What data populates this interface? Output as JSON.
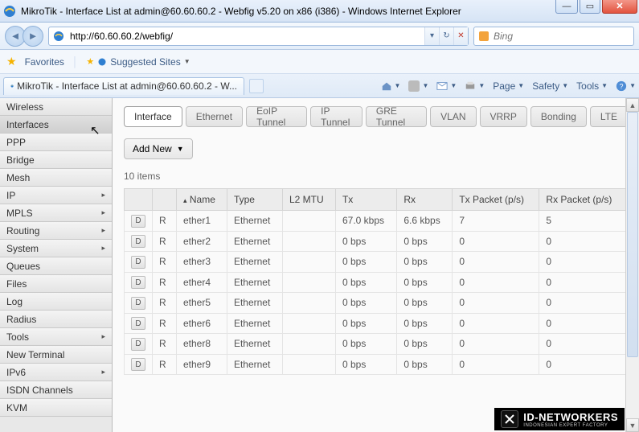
{
  "window": {
    "title": "MikroTik - Interface List at admin@60.60.60.2 - Webfig v5.20 on x86 (i386) - Windows Internet Explorer"
  },
  "address": {
    "url": "http://60.60.60.2/webfig/"
  },
  "search": {
    "placeholder": "Bing"
  },
  "favorites": {
    "label": "Favorites",
    "suggested": "Suggested Sites"
  },
  "ietab": {
    "label": "MikroTik - Interface List at admin@60.60.60.2 - W..."
  },
  "ie_tools": {
    "page": "Page",
    "safety": "Safety",
    "tools": "Tools"
  },
  "sidebar": {
    "items": [
      {
        "label": "Wireless",
        "sub": false
      },
      {
        "label": "Interfaces",
        "sub": false,
        "active": true
      },
      {
        "label": "PPP",
        "sub": false
      },
      {
        "label": "Bridge",
        "sub": false
      },
      {
        "label": "Mesh",
        "sub": false
      },
      {
        "label": "IP",
        "sub": true
      },
      {
        "label": "MPLS",
        "sub": true
      },
      {
        "label": "Routing",
        "sub": true
      },
      {
        "label": "System",
        "sub": true
      },
      {
        "label": "Queues",
        "sub": false
      },
      {
        "label": "Files",
        "sub": false
      },
      {
        "label": "Log",
        "sub": false
      },
      {
        "label": "Radius",
        "sub": false
      },
      {
        "label": "Tools",
        "sub": true
      },
      {
        "label": "New Terminal",
        "sub": false
      },
      {
        "label": "IPv6",
        "sub": true
      },
      {
        "label": "ISDN Channels",
        "sub": false
      },
      {
        "label": "KVM",
        "sub": false
      }
    ]
  },
  "tabs": [
    {
      "label": "Interface",
      "active": true
    },
    {
      "label": "Ethernet"
    },
    {
      "label": "EoIP Tunnel"
    },
    {
      "label": "IP Tunnel"
    },
    {
      "label": "GRE Tunnel"
    },
    {
      "label": "VLAN"
    },
    {
      "label": "VRRP"
    },
    {
      "label": "Bonding"
    },
    {
      "label": "LTE"
    }
  ],
  "addnew": "Add New",
  "itemcount": "10 items",
  "table": {
    "headers": {
      "d": "",
      "flag": "",
      "name": "Name",
      "type": "Type",
      "l2mtu": "L2 MTU",
      "tx": "Tx",
      "rx": "Rx",
      "txp": "Tx Packet (p/s)",
      "rxp": "Rx Packet (p/s)"
    },
    "rows": [
      {
        "d": "D",
        "flag": "R",
        "name": "ether1",
        "type": "Ethernet",
        "l2mtu": "",
        "tx": "67.0 kbps",
        "rx": "6.6 kbps",
        "txp": "7",
        "rxp": "5"
      },
      {
        "d": "D",
        "flag": "R",
        "name": "ether2",
        "type": "Ethernet",
        "l2mtu": "",
        "tx": "0 bps",
        "rx": "0 bps",
        "txp": "0",
        "rxp": "0"
      },
      {
        "d": "D",
        "flag": "R",
        "name": "ether3",
        "type": "Ethernet",
        "l2mtu": "",
        "tx": "0 bps",
        "rx": "0 bps",
        "txp": "0",
        "rxp": "0"
      },
      {
        "d": "D",
        "flag": "R",
        "name": "ether4",
        "type": "Ethernet",
        "l2mtu": "",
        "tx": "0 bps",
        "rx": "0 bps",
        "txp": "0",
        "rxp": "0"
      },
      {
        "d": "D",
        "flag": "R",
        "name": "ether5",
        "type": "Ethernet",
        "l2mtu": "",
        "tx": "0 bps",
        "rx": "0 bps",
        "txp": "0",
        "rxp": "0"
      },
      {
        "d": "D",
        "flag": "R",
        "name": "ether6",
        "type": "Ethernet",
        "l2mtu": "",
        "tx": "0 bps",
        "rx": "0 bps",
        "txp": "0",
        "rxp": "0"
      },
      {
        "d": "D",
        "flag": "R",
        "name": "ether8",
        "type": "Ethernet",
        "l2mtu": "",
        "tx": "0 bps",
        "rx": "0 bps",
        "txp": "0",
        "rxp": "0"
      },
      {
        "d": "D",
        "flag": "R",
        "name": "ether9",
        "type": "Ethernet",
        "l2mtu": "",
        "tx": "0 bps",
        "rx": "0 bps",
        "txp": "0",
        "rxp": "0"
      }
    ]
  },
  "watermark": {
    "name": "ID-NETWORKERS",
    "sub": "INDONESIAN EXPERT FACTORY"
  }
}
